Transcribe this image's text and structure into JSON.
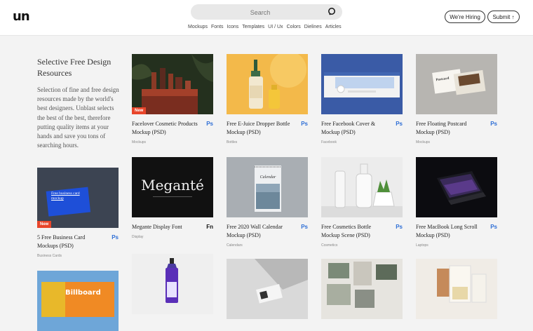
{
  "header": {
    "logo": "un",
    "search_placeholder": "Search",
    "nav": [
      "Mockups",
      "Fonts",
      "Icons",
      "Templates",
      "UI / Ux",
      "Colors",
      "Dielines",
      "Articles"
    ],
    "hiring_label": "We're Hiring",
    "submit_label": "Submit ↑"
  },
  "intro": {
    "title": "Selective Free Design Resources",
    "description": "Selection of fine and free design resources made by the world's best designers. Unblast selects the best of the best, therefore putting quality items at your hands and save you tons of searching hours."
  },
  "cards": [
    {
      "title": "Facelover Cosmetic Products Mockup (PSD)",
      "tag": "Mockups",
      "icon": "Ps",
      "badge": "New"
    },
    {
      "title": "Free E-Juice Dropper Bottle Mockup (PSD)",
      "tag": "Bottles",
      "icon": "Ps"
    },
    {
      "title": "Free Facebook Cover & Mockup (PSD)",
      "tag": "Facebook",
      "icon": "Ps"
    },
    {
      "title": "Free Floating Postcard Mockup (PSD)",
      "tag": "Mockups",
      "icon": "Ps",
      "image_text": "Postcard"
    },
    {
      "title": "5 Free Business Card Mockups (PSD)",
      "tag": "Business Cards",
      "icon": "Ps",
      "badge": "New",
      "image_text": "Free business card mockup"
    },
    {
      "title": "Megante Display Font",
      "tag": "Display",
      "icon": "Fn",
      "image_text": "Meganté"
    },
    {
      "title": "Free 2020 Wall Calendar Mockup (PSD)",
      "tag": "Calendars",
      "icon": "Ps",
      "image_text": "Calendar"
    },
    {
      "title": "Free Cosmetics Bottle Mockup Scene (PSD)",
      "tag": "Cosmetics",
      "icon": "Ps"
    },
    {
      "title": "Free MacBook Long Scroll Mockup (PSD)",
      "tag": "Laptops",
      "icon": "Ps"
    },
    {
      "image_text": "Billboard"
    }
  ],
  "colors": {
    "accent_blue": "#2f6fd6",
    "badge_red": "#e8452a"
  }
}
